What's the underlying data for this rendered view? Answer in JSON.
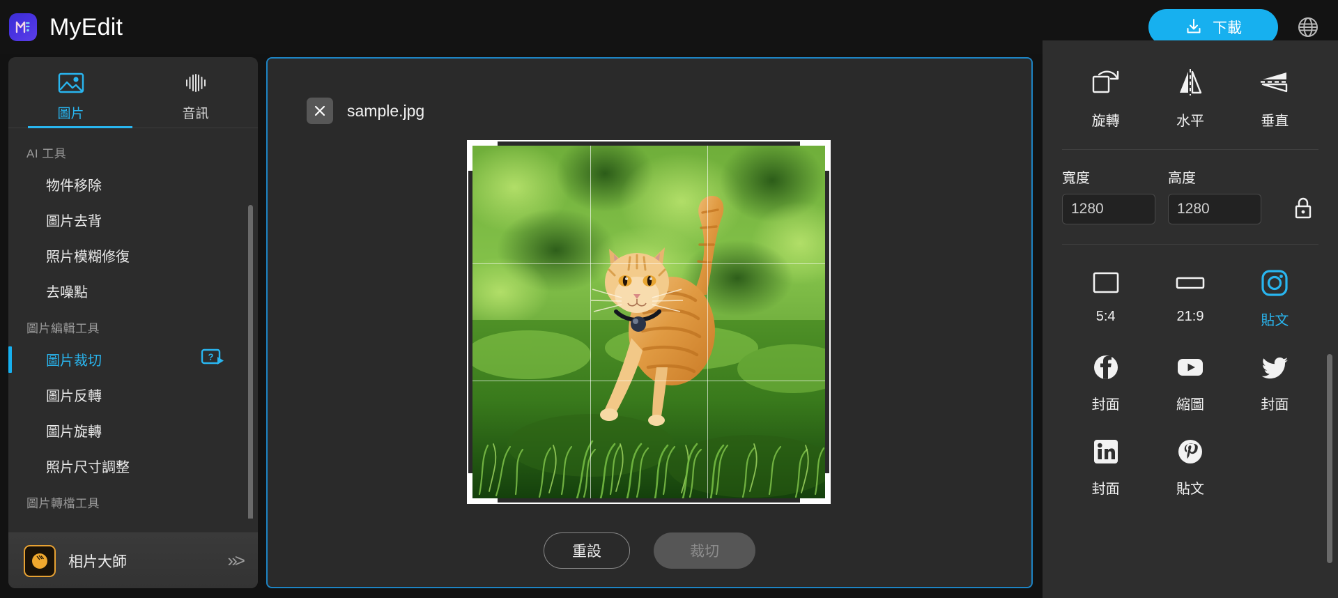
{
  "app": {
    "brand_name": "MyEdit",
    "logo_icon": "myedit-logo"
  },
  "topbar": {
    "download_label": "下載",
    "download_icon": "download-icon",
    "language_icon": "globe-icon",
    "accent_color": "#17b0ef"
  },
  "sidebar": {
    "tabs": [
      {
        "label": "圖片",
        "icon": "image-icon",
        "active": true
      },
      {
        "label": "音訊",
        "icon": "audio-wave-icon",
        "active": false
      }
    ],
    "groups": [
      {
        "label": "AI 工具",
        "items": [
          {
            "label": "物件移除",
            "active": false
          },
          {
            "label": "圖片去背",
            "active": false
          },
          {
            "label": "照片模糊修復",
            "active": false
          },
          {
            "label": "去噪點",
            "active": false
          }
        ]
      },
      {
        "label": "圖片編輯工具",
        "items": [
          {
            "label": "圖片裁切",
            "active": true,
            "help_icon": "help-video-icon"
          },
          {
            "label": "圖片反轉",
            "active": false
          },
          {
            "label": "圖片旋轉",
            "active": false
          },
          {
            "label": "照片尺寸調整",
            "active": false
          }
        ]
      },
      {
        "label": "圖片轉檔工具",
        "items": []
      }
    ],
    "promo": {
      "label": "相片大師",
      "icon": "photodirector-icon",
      "arrow": "»>"
    }
  },
  "canvas": {
    "close_icon": "close-icon",
    "filename": "sample.jpg",
    "image_alt": "orange-tabby-cat-walking-in-grass",
    "crop_grid_lines": 2,
    "buttons": {
      "reset_label": "重設",
      "crop_label": "裁切",
      "crop_disabled": true
    }
  },
  "right_panel": {
    "transform": [
      {
        "label": "旋轉",
        "icon": "rotate-icon"
      },
      {
        "label": "水平",
        "icon": "flip-horizontal-icon"
      },
      {
        "label": "垂直",
        "icon": "flip-vertical-icon"
      }
    ],
    "size": {
      "width_label": "寬度",
      "height_label": "高度",
      "width_value": "1280",
      "height_value": "1280",
      "lock_icon": "lock-icon",
      "lock_state": "locked"
    },
    "ratios": [
      {
        "label": "5:4",
        "icon": "rect-5-4-icon",
        "active": false
      },
      {
        "label": "21:9",
        "icon": "rect-21-9-icon",
        "active": false
      },
      {
        "label": "貼文",
        "icon": "instagram-icon",
        "active": true
      },
      {
        "label": "封面",
        "icon": "facebook-icon",
        "active": false
      },
      {
        "label": "縮圖",
        "icon": "youtube-icon",
        "active": false
      },
      {
        "label": "封面",
        "icon": "twitter-icon",
        "active": false
      },
      {
        "label": "封面",
        "icon": "linkedin-icon",
        "active": false
      },
      {
        "label": "貼文",
        "icon": "pinterest-icon",
        "active": false
      }
    ]
  }
}
